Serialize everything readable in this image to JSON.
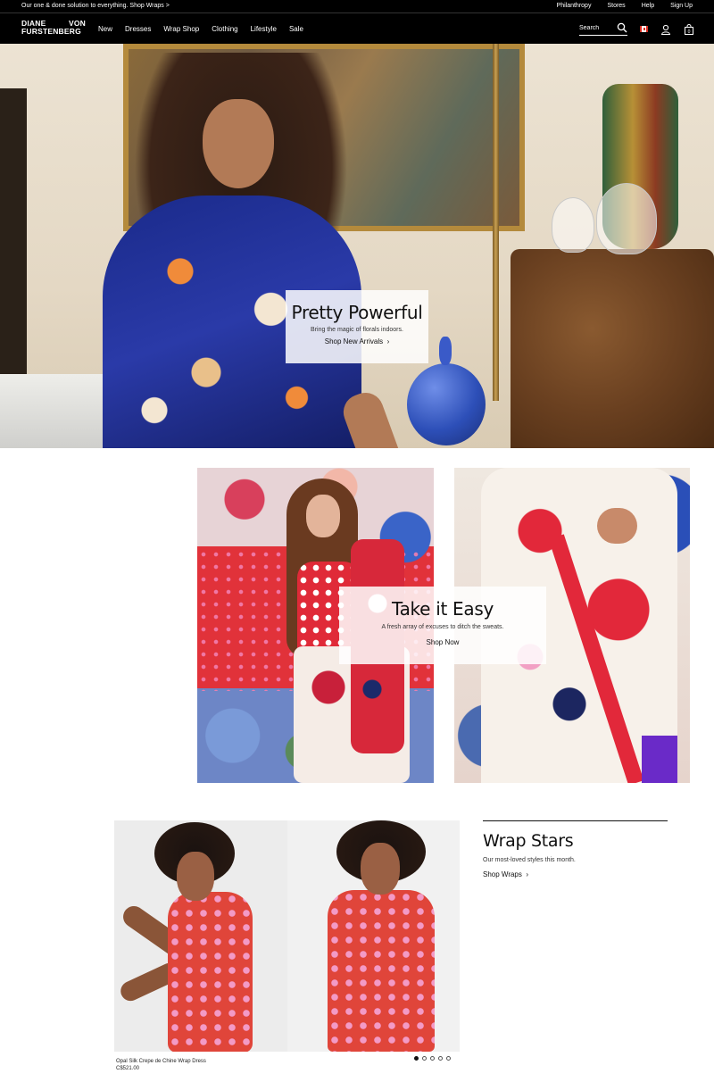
{
  "topbar": {
    "promo": "Our one & done solution to everything. Shop Wraps >",
    "links": [
      "Philanthropy",
      "Stores",
      "Help",
      "Sign Up"
    ]
  },
  "nav": {
    "logo_line1_left": "DIANE",
    "logo_line1_right": "VON",
    "logo_line2": "FURSTENBERG",
    "menu": [
      "New",
      "Dresses",
      "Wrap Shop",
      "Clothing",
      "Lifestyle",
      "Sale"
    ],
    "search_placeholder": "Search",
    "icons": [
      "search-icon",
      "flag-icon",
      "account-icon",
      "bag-icon"
    ],
    "bag_count": "0"
  },
  "hero": {
    "title": "Pretty Powerful",
    "subtitle": "Bring the magic of florals indoors.",
    "cta": "Shop New Arrivals"
  },
  "easy": {
    "title": "Take it Easy",
    "subtitle": "A fresh array of excuses to ditch the sweats.",
    "cta": "Shop Now"
  },
  "wrap": {
    "title": "Wrap Stars",
    "subtitle": "Our most-loved styles this month.",
    "cta": "Shop Wraps",
    "product_name": "Opal Silk Crepe de Chine Wrap Dress",
    "product_price": "C$521.00",
    "carousel_count": 5,
    "carousel_active": 1
  },
  "colors": {
    "nav_bg": "#000000",
    "text": "#111111",
    "accent_red": "#e0453a"
  }
}
